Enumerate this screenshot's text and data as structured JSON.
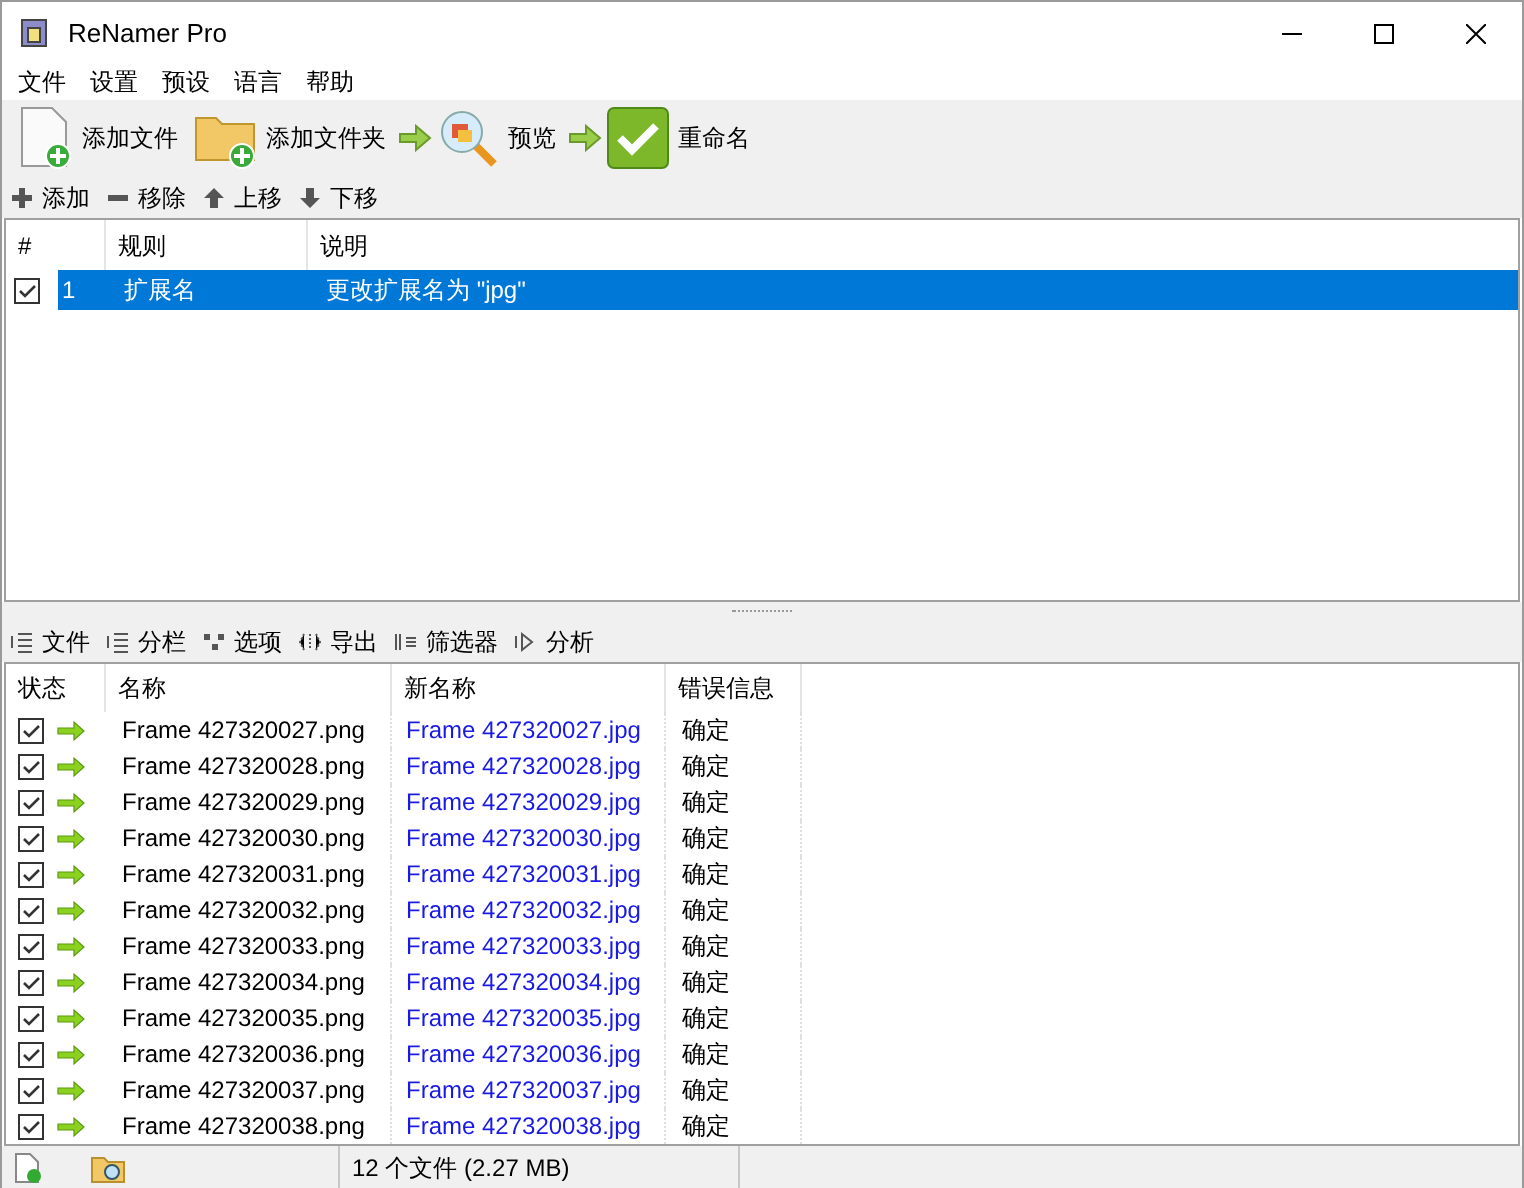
{
  "window": {
    "title": "ReNamer Pro"
  },
  "menu": [
    "文件",
    "设置",
    "预设",
    "语言",
    "帮助"
  ],
  "toolbar": [
    {
      "kind": "file",
      "label": "添加文件"
    },
    {
      "kind": "folder",
      "label": "添加文件夹"
    },
    {
      "kind": "preview",
      "label": "预览"
    },
    {
      "kind": "rename",
      "label": "重命名"
    }
  ],
  "rules_toolbar": [
    {
      "kind": "add",
      "label": "添加"
    },
    {
      "kind": "remove",
      "label": "移除"
    },
    {
      "kind": "up",
      "label": "上移"
    },
    {
      "kind": "down",
      "label": "下移"
    }
  ],
  "rules_table": {
    "columns": [
      "#",
      "规则",
      "说明"
    ],
    "rows": [
      {
        "checked": true,
        "selected": true,
        "index": "1",
        "rule": "扩展名",
        "description": "更改扩展名为 \"jpg\""
      }
    ]
  },
  "files_toolbar": [
    {
      "kind": "files",
      "label": "文件"
    },
    {
      "kind": "columns",
      "label": "分栏"
    },
    {
      "kind": "options",
      "label": "选项"
    },
    {
      "kind": "export",
      "label": "导出"
    },
    {
      "kind": "filter",
      "label": "筛选器"
    },
    {
      "kind": "analyze",
      "label": "分析"
    }
  ],
  "files_table": {
    "columns": [
      "状态",
      "名称",
      "新名称",
      "错误信息"
    ],
    "rows": [
      {
        "checked": true,
        "name": "Frame 427320027.png",
        "new_name": "Frame 427320027.jpg",
        "error": "确定"
      },
      {
        "checked": true,
        "name": "Frame 427320028.png",
        "new_name": "Frame 427320028.jpg",
        "error": "确定"
      },
      {
        "checked": true,
        "name": "Frame 427320029.png",
        "new_name": "Frame 427320029.jpg",
        "error": "确定"
      },
      {
        "checked": true,
        "name": "Frame 427320030.png",
        "new_name": "Frame 427320030.jpg",
        "error": "确定"
      },
      {
        "checked": true,
        "name": "Frame 427320031.png",
        "new_name": "Frame 427320031.jpg",
        "error": "确定"
      },
      {
        "checked": true,
        "name": "Frame 427320032.png",
        "new_name": "Frame 427320032.jpg",
        "error": "确定"
      },
      {
        "checked": true,
        "name": "Frame 427320033.png",
        "new_name": "Frame 427320033.jpg",
        "error": "确定"
      },
      {
        "checked": true,
        "name": "Frame 427320034.png",
        "new_name": "Frame 427320034.jpg",
        "error": "确定"
      },
      {
        "checked": true,
        "name": "Frame 427320035.png",
        "new_name": "Frame 427320035.jpg",
        "error": "确定"
      },
      {
        "checked": true,
        "name": "Frame 427320036.png",
        "new_name": "Frame 427320036.jpg",
        "error": "确定"
      },
      {
        "checked": true,
        "name": "Frame 427320037.png",
        "new_name": "Frame 427320037.jpg",
        "error": "确定"
      },
      {
        "checked": true,
        "name": "Frame 427320038.png",
        "new_name": "Frame 427320038.jpg",
        "error": "确定"
      }
    ]
  },
  "status_bar": {
    "text": "12 个文件 (2.27 MB)"
  }
}
